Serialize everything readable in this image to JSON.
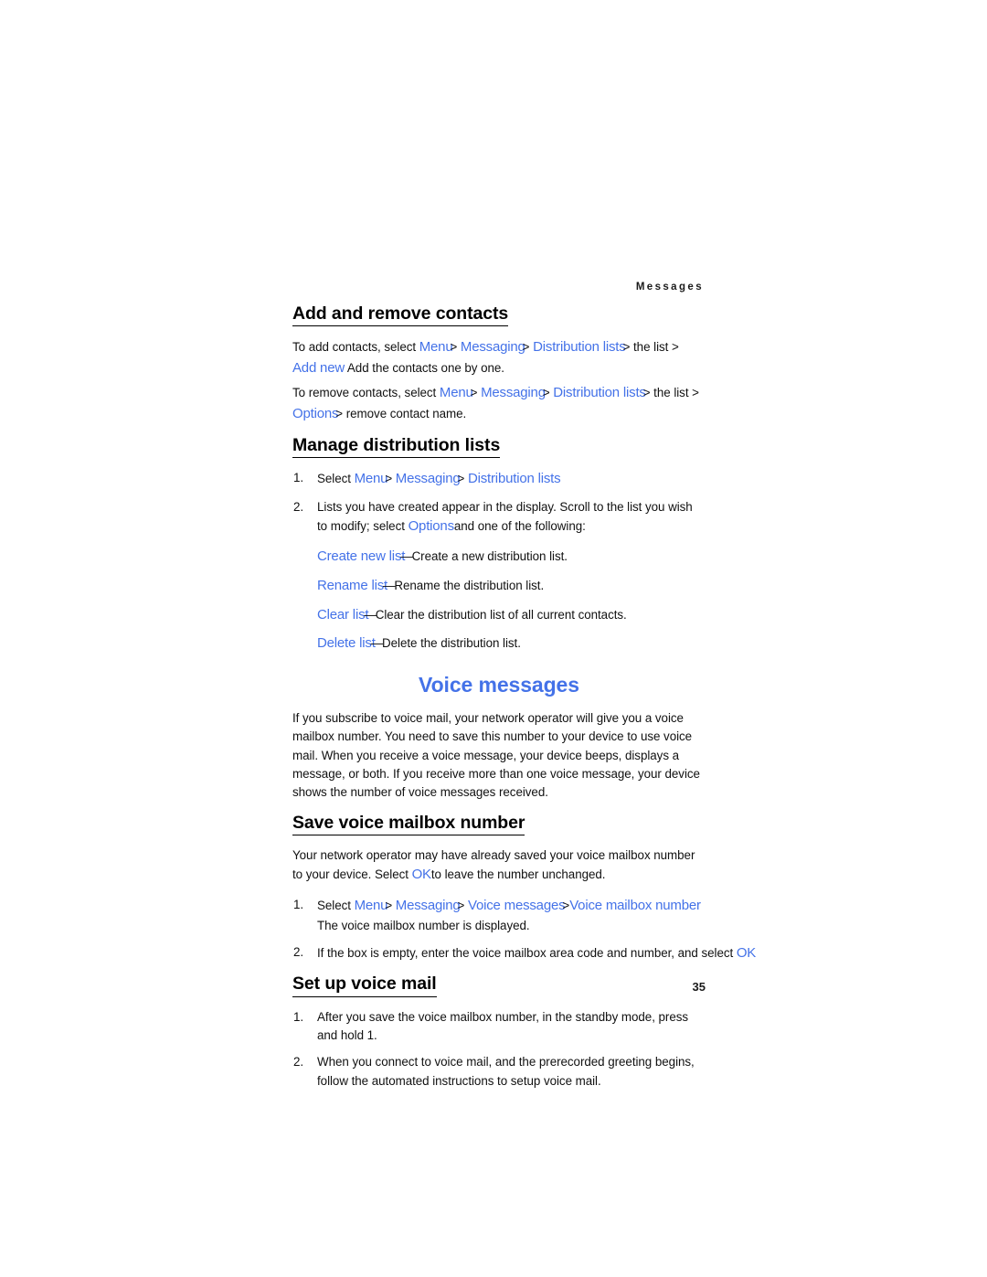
{
  "page": {
    "running_header": "Messages",
    "page_number": "35",
    "accent_blue": "#4472e8",
    "text_color": "#111111",
    "background": "#ffffff"
  },
  "sections": {
    "add_remove": {
      "heading": "Add and remove contacts",
      "para1": {
        "lead": "To add contacts, select ",
        "ui1": "Menu",
        "sep1": ">",
        "ui2": "Messaging",
        "sep2": ">",
        "ui3": "Distribution lists",
        "sep3": ">",
        "mid": " the list > ",
        "ui4": "Add new",
        "tail": "Add the contacts one by one."
      },
      "para2": {
        "lead": "To remove contacts, select ",
        "ui1": "Menu",
        "sep1": ">",
        "ui2": "Messaging",
        "sep2": ">",
        "ui3": "Distribution lists",
        "sep3": ">",
        "mid": " the list > ",
        "ui4": "Options",
        "sep4": ">",
        "tail": " remove contact name."
      }
    },
    "manage_lists": {
      "heading": "Manage distribution lists",
      "step1": {
        "lead": "Select ",
        "ui1": "Menu",
        "sep1": ">",
        "ui2": "Messaging",
        "sep2": ">",
        "ui3": "Distribution lists"
      },
      "step2": {
        "lead": "Lists you have created appear in the display. Scroll to the list you wish to modify; select ",
        "ui1": "Options",
        "tail": "and one of the following:"
      },
      "options": [
        {
          "term": "Create new list",
          "dash": "—",
          "desc": "Create a new distribution list."
        },
        {
          "term": "Rename list",
          "dash": "—",
          "desc": "Rename the distribution list."
        },
        {
          "term": "Clear list",
          "dash": "—",
          "desc": "Clear the distribution list of all current contacts."
        },
        {
          "term": "Delete list",
          "dash": "—",
          "desc": "Delete the distribution list."
        }
      ]
    },
    "voice_messages": {
      "heading": "Voice messages",
      "intro": "If you subscribe to voice mail, your network operator will give you a voice mailbox number. You need to save this number to your device to use voice mail. When you receive a voice message, your device beeps, displays a message, or both. If you receive more than one voice message, your device shows the number of voice messages received."
    },
    "save_mailbox": {
      "heading": "Save voice mailbox number",
      "intro": {
        "lead": "Your network operator may have already saved your voice mailbox number to your device. Select ",
        "ui1": "OK",
        "tail": "to leave the number unchanged."
      },
      "step1": {
        "lead": "Select ",
        "ui1": "Menu",
        "sep1": ">",
        "ui2": "Messaging",
        "sep2": ">",
        "ui3": "Voice messages",
        "sep3": ">",
        "ui4": "Voice mailbox number",
        "tail": "The voice mailbox number is displayed."
      },
      "step2": {
        "lead": "If the box is empty, enter the voice mailbox area code and number, and select ",
        "ui1": "OK",
        "tail": "."
      }
    },
    "setup_voicemail": {
      "heading": "Set up voice mail",
      "step1": "After you save the voice mailbox number, in the standby mode, press and hold 1.",
      "step2": "When you connect to voice mail, and the prerecorded greeting begins, follow the automated instructions to setup voice mail."
    }
  }
}
